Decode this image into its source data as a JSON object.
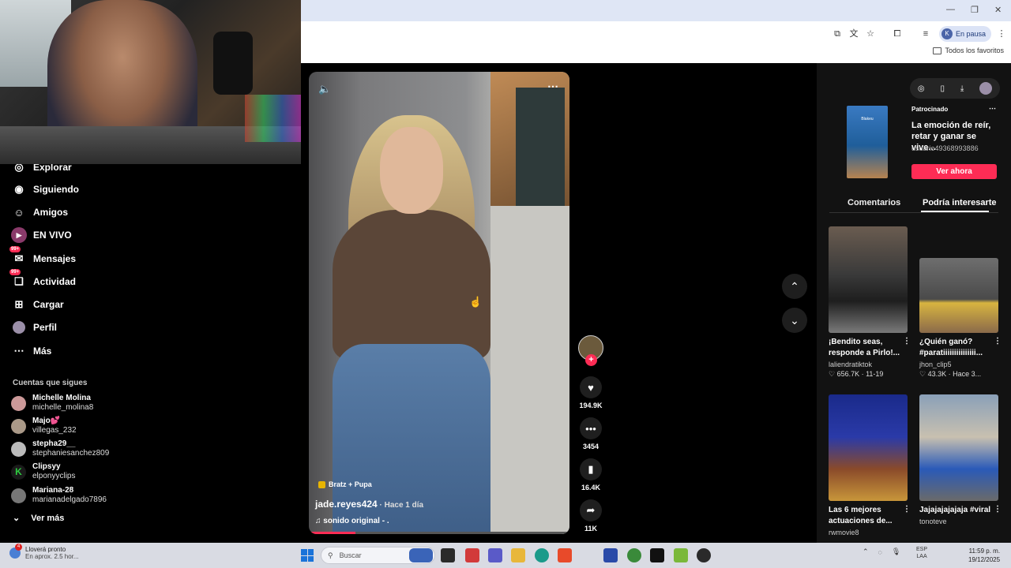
{
  "browser": {
    "profile_initial": "K",
    "profile_status": "En pausa",
    "bookmarks_folder": "Todos los favoritos",
    "window_controls": [
      "—",
      "❐",
      "✕"
    ]
  },
  "nav": {
    "items": [
      {
        "label": "Explorar",
        "icon": "compass-icon"
      },
      {
        "label": "Siguiendo",
        "icon": "following-icon"
      },
      {
        "label": "Amigos",
        "icon": "friends-icon"
      },
      {
        "label": "EN VIVO",
        "icon": "live-icon"
      },
      {
        "label": "Mensajes",
        "icon": "messages-icon",
        "badge": "99+"
      },
      {
        "label": "Actividad",
        "icon": "activity-icon",
        "badge": "99+"
      },
      {
        "label": "Cargar",
        "icon": "upload-icon"
      },
      {
        "label": "Perfil",
        "icon": "profile-icon"
      },
      {
        "label": "Más",
        "icon": "more-icon"
      }
    ],
    "following_title": "Cuentas que sigues",
    "accounts": [
      {
        "name": "Michelle Molina",
        "handle": "michelle_molina8"
      },
      {
        "name": "Majo💕",
        "handle": "villegas_232"
      },
      {
        "name": "stepha29__",
        "handle": "stephaniesanchez809"
      },
      {
        "name": "Clipsyy",
        "handle": "elponyyclips"
      },
      {
        "name": "Mariana-28",
        "handle": "marianadelgado7896"
      }
    ],
    "see_more": "Ver más"
  },
  "video": {
    "music_tag": "Bratz + Pupa",
    "author": "jade.reyes424",
    "time": " · Hace 1 día",
    "sound": "sonido original - .",
    "progress": 0.18
  },
  "actions": {
    "likes": "194.9K",
    "comments": "3454",
    "saves": "16.4K",
    "shares": "11K"
  },
  "ad": {
    "sponsored": "Patrocinado",
    "brand_in_thumb": "Blakeu",
    "title": "La emoción de reír, retar y ganar se vive...",
    "user": "usuario49368993886",
    "cta": "Ver ahora"
  },
  "tabs": {
    "comments": "Comentarios",
    "suggested": "Podría interesarte"
  },
  "cards": [
    {
      "title": "¡Bendito seas, responde a Pirlo!...",
      "user": "laliendratiktok",
      "stats": "♡ 656.7K · 11-19"
    },
    {
      "title": "¿Quién ganó? #paratiiiiiiiiiiiiiii...",
      "user": "jhon_clip5",
      "stats": "♡ 43.3K · Hace 3..."
    },
    {
      "title": "Las 6 mejores actuaciones de...",
      "user": "rwmovie8",
      "stats": ""
    },
    {
      "title": "Jajajajajajaja #viral",
      "user": "tonoteve",
      "stats": ""
    }
  ],
  "taskbar": {
    "weather_notif": "4",
    "weather_line1": "Lloverá pronto",
    "weather_line2": "En aprox. 2.5 hor...",
    "search_placeholder": "Buscar",
    "lang1": "ESP",
    "lang2": "LAA",
    "time": "11:59 p. m.",
    "date": "19/12/2025"
  }
}
